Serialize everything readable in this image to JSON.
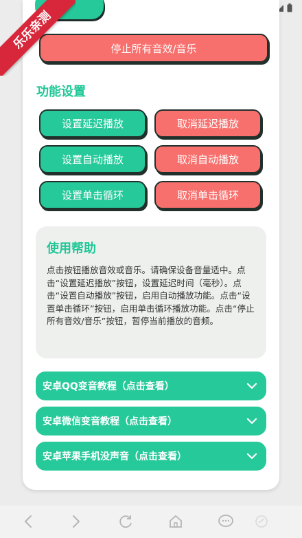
{
  "watermark": "乐乐亲测",
  "actions": {
    "stop_all": "停止所有音效/音乐"
  },
  "settings": {
    "title": "功能设置",
    "buttons": [
      {
        "set": "设置延迟播放",
        "cancel": "取消延迟播放"
      },
      {
        "set": "设置自动播放",
        "cancel": "取消自动播放"
      },
      {
        "set": "设置单击循环",
        "cancel": "取消单击循环"
      }
    ]
  },
  "help": {
    "title": "使用帮助",
    "text": "点击按钮播放音效或音乐。请确保设备音量适中。点击“设置延迟播放”按钮，设置延迟时间（毫秒）。点击“设置自动播放”按钮，启用自动播放功能。点击“设置单击循环”按钮，启用单击循环播放功能。点击“停止所有音效/音乐”按钮，暂停当前播放的音频。"
  },
  "tutorials": [
    "安卓QQ变音教程（点击查看）",
    "安卓微信变音教程（点击查看）",
    "安卓苹果手机没声音（点击查看）"
  ],
  "colors": {
    "green": "#26c99a",
    "red": "#f7706d",
    "title_green": "#1ec796",
    "ribbon": "#d8273a"
  },
  "icons": {
    "status": [
      "wifi-icon",
      "signal-icon",
      "battery-icon"
    ],
    "nav": [
      "back-icon",
      "forward-icon",
      "refresh-icon",
      "home-icon",
      "chat-icon",
      "share-icon"
    ]
  }
}
